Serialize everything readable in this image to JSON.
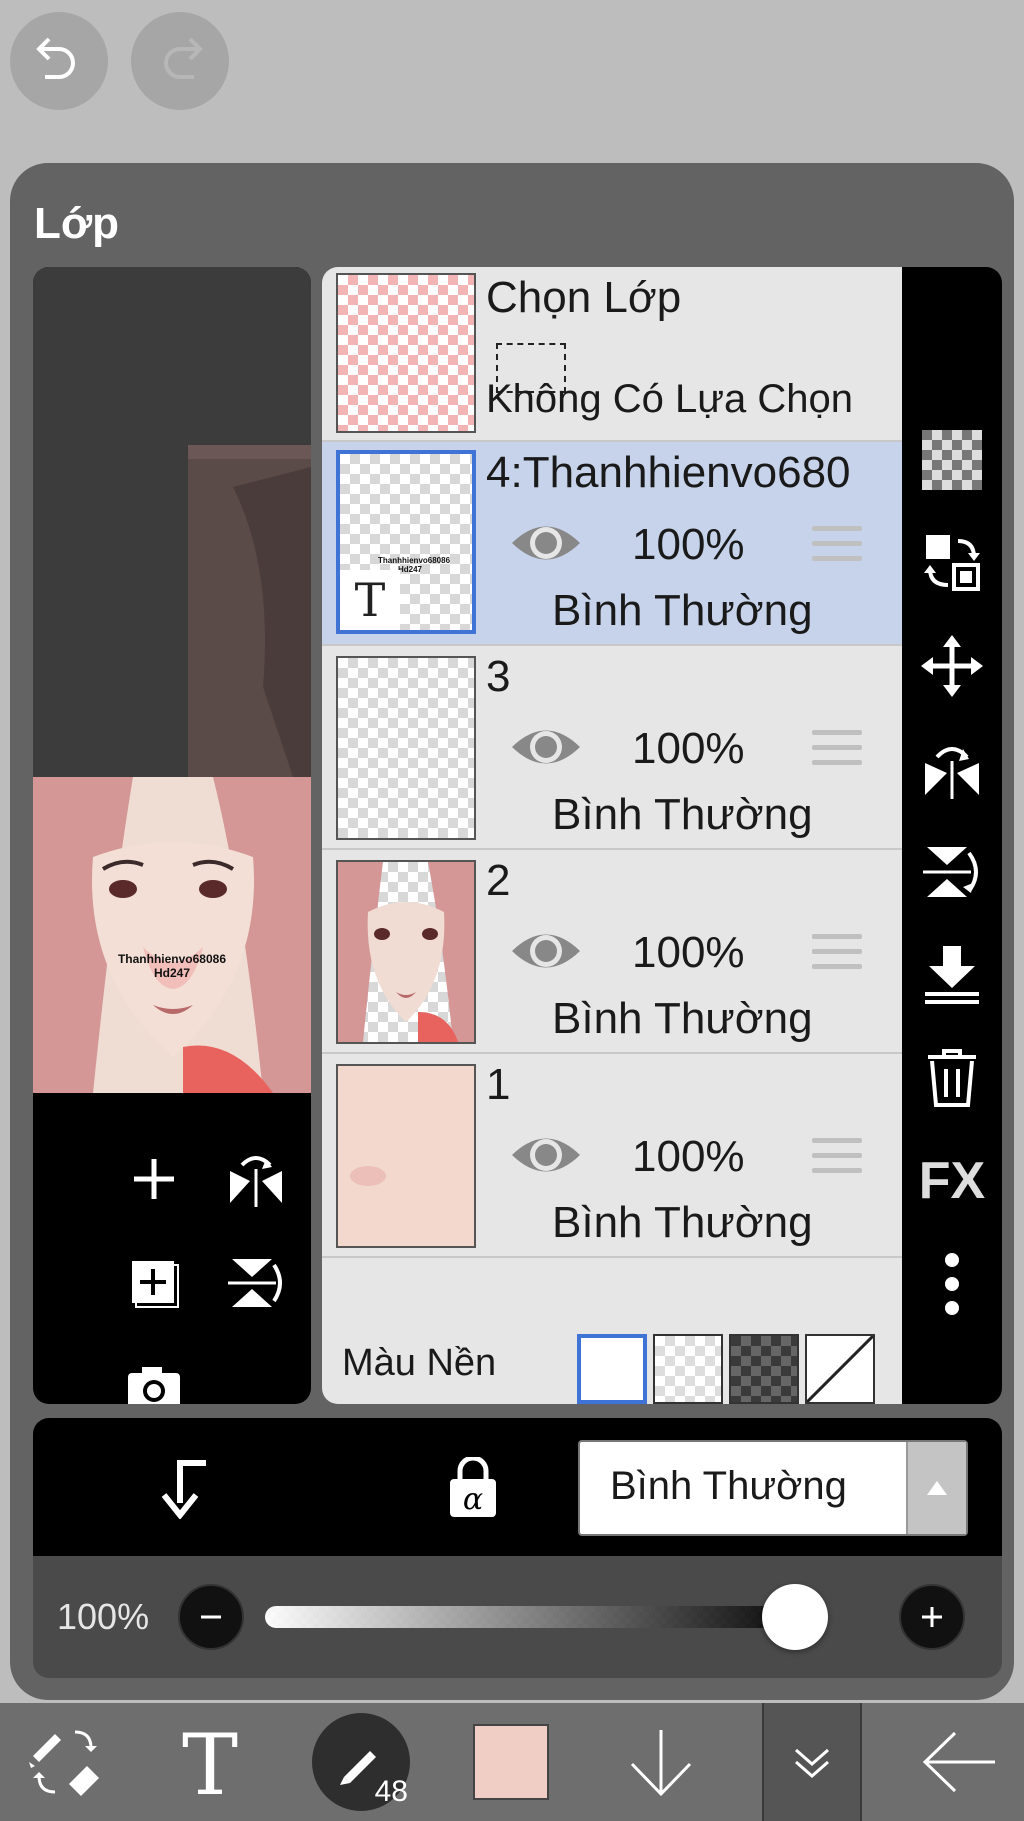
{
  "panel": {
    "title": "Lớp"
  },
  "preview_watermark": {
    "line1": "Thanhhienvo68086",
    "line2": "Hd247"
  },
  "selection_row": {
    "title": "Chọn Lớp",
    "status": "Không Có Lựa Chọn"
  },
  "layers": [
    {
      "name": "4:Thanhhienvo680",
      "opacity": "100%",
      "blend": "Bình Thường",
      "thumb_label": "T",
      "selected": true
    },
    {
      "name": "3",
      "opacity": "100%",
      "blend": "Bình Thường",
      "selected": false
    },
    {
      "name": "2",
      "opacity": "100%",
      "blend": "Bình Thường",
      "selected": false
    },
    {
      "name": "1",
      "opacity": "100%",
      "blend": "Bình Thường",
      "selected": false
    }
  ],
  "background_row": {
    "label": "Màu Nền"
  },
  "side_tools": {
    "fx_label": "FX"
  },
  "action_bar": {
    "blend_mode": "Bình Thường"
  },
  "opacity_bar": {
    "value": "100%",
    "level": 1.0
  },
  "toolbar": {
    "brush_size": "48",
    "current_color": "#f0cdc5"
  },
  "colors": {
    "selected_row": "#c6d3ea",
    "accent_blue": "#3f73d6",
    "panel_bg": "#636363"
  }
}
